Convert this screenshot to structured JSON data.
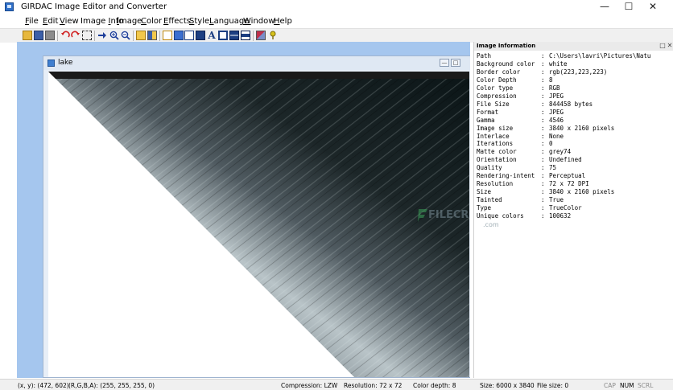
{
  "app": {
    "title": "GIRDAC Image Editor and Converter"
  },
  "window_controls": {
    "minimize": "—",
    "maximize": "☐",
    "close": "✕"
  },
  "menu": {
    "items": [
      {
        "label": "File",
        "underline": "F",
        "rest": "ile"
      },
      {
        "label": "Edit",
        "underline": "E",
        "rest": "dit"
      },
      {
        "label": "View",
        "underline": "V",
        "rest": "iew"
      },
      {
        "label": "Image Info",
        "prefix": "Image ",
        "underline": "I",
        "rest": "nfo"
      },
      {
        "label": "Image",
        "prefix": "",
        "underline": "I",
        "rest": "mage"
      },
      {
        "label": "Color",
        "underline": "C",
        "rest": "olor"
      },
      {
        "label": "Effects",
        "underline": "E",
        "rest": "ffects"
      },
      {
        "label": "Style",
        "underline": "S",
        "rest": "tyle"
      },
      {
        "label": "Language",
        "underline": "L",
        "rest": "anguage"
      },
      {
        "label": "Window",
        "underline": "W",
        "rest": "indow"
      },
      {
        "label": "Help",
        "underline": "H",
        "rest": "elp"
      }
    ]
  },
  "toolbar": {
    "icons": [
      "open-icon",
      "save-icon",
      "print-icon",
      "undo-icon",
      "redo-icon",
      "select-icon",
      "forward-icon",
      "zoom-in-icon",
      "zoom-out-icon",
      "panel-icon",
      "panel-alt-icon",
      "rect-icon",
      "image-icon",
      "window-icon",
      "layers-icon",
      "text-icon",
      "frame-icon",
      "split-h-icon",
      "split-v-icon",
      "eraser-icon",
      "pin-icon"
    ]
  },
  "child_window": {
    "title": "lake",
    "min_glyph": "—",
    "max_glyph": "□"
  },
  "panel": {
    "title": "Image Information",
    "restore_glyph": "□",
    "close_glyph": "✕",
    "rows": [
      {
        "key": "Path",
        "value": "C:\\Users\\lavri\\Pictures\\Natu"
      },
      {
        "key": "Background color",
        "value": "white"
      },
      {
        "key": "Border color",
        "value": "rgb(223,223,223)"
      },
      {
        "key": "Color Depth",
        "value": "8"
      },
      {
        "key": "Color type",
        "value": "RGB"
      },
      {
        "key": "Compression",
        "value": "JPEG"
      },
      {
        "key": "File Size",
        "value": "844458 bytes"
      },
      {
        "key": "Format",
        "value": "JPEG"
      },
      {
        "key": "Gamma",
        "value": "4546"
      },
      {
        "key": "Image size",
        "value": "3840 x 2160 pixels"
      },
      {
        "key": "Interlace",
        "value": "None"
      },
      {
        "key": "Iterations",
        "value": "0"
      },
      {
        "key": "Matte color",
        "value": "grey74"
      },
      {
        "key": "Orientation",
        "value": "Undefined"
      },
      {
        "key": "Quality",
        "value": "75"
      },
      {
        "key": "Rendering-intent",
        "value": "Perceptual"
      },
      {
        "key": "Resolution",
        "value": "72 x 72 DPI"
      },
      {
        "key": "Size",
        "value": "3840 x 2160 pixels"
      },
      {
        "key": "Tainted",
        "value": "True"
      },
      {
        "key": "Type",
        "value": "TrueColor"
      },
      {
        "key": "Unique colors",
        "value": "100632"
      }
    ],
    "separator": ":"
  },
  "watermark": {
    "brand": "FILECR",
    "suffix": ".com"
  },
  "status": {
    "coords": "(x, y): (472, 602)",
    "rgba": "(R,G,B,A): (255, 255, 255, 0)",
    "compression": "Compression: LZW",
    "resolution": "Resolution: 72 x 72",
    "color_depth": "Color depth: 8",
    "size": "Size: 6000 x 3840",
    "file_size": "File size: 0",
    "cap": "CAP",
    "num": "NUM",
    "scrl": "SCRL"
  }
}
